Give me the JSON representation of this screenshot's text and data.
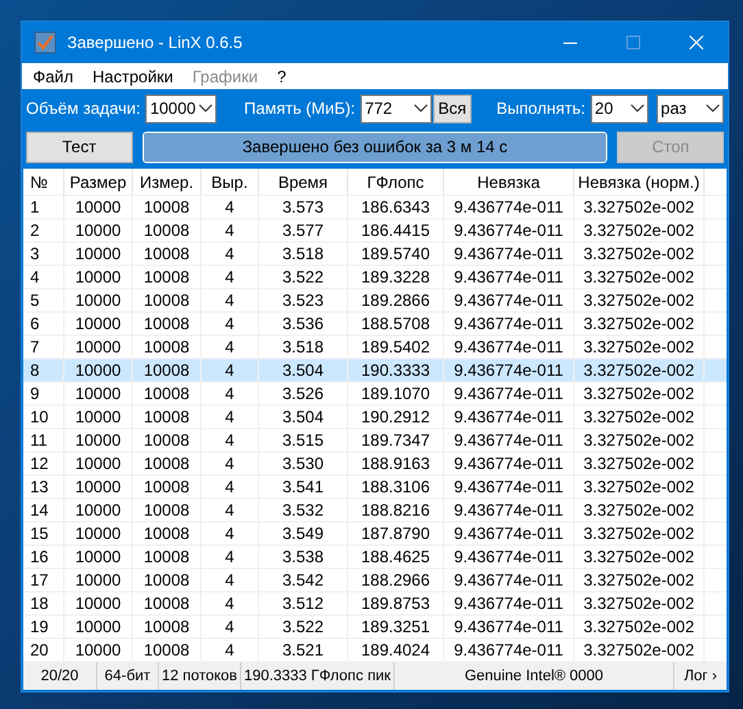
{
  "window": {
    "title": "Завершено - LinX 0.6.5"
  },
  "menu": [
    {
      "label": "Файл",
      "disabled": false
    },
    {
      "label": "Настройки",
      "disabled": false
    },
    {
      "label": "Графики",
      "disabled": true
    },
    {
      "label": "?",
      "disabled": false
    }
  ],
  "options": [
    {
      "label": "Объём задачи:",
      "value": "10000"
    },
    {
      "label": "Память (МиБ):",
      "value": "772",
      "extra": "Вся"
    },
    {
      "label": "Выполнять:",
      "value": "20",
      "units": "раз"
    }
  ],
  "buttons": {
    "start": {
      "label": "Тест",
      "disabled": false
    },
    "stop": {
      "label": "Стоп",
      "disabled": true
    }
  },
  "progress": {
    "text": "Завершено без ошибок за 3 м 14 с",
    "level": 1
  },
  "table": {
    "columns": [
      "№",
      "Размер",
      "Измер.",
      "Выр.",
      "Время",
      "ГФлопс",
      "Невязка",
      "Невязка (норм.)"
    ],
    "rows": [
      {
        "cells": [
          "1",
          "10000",
          "10008",
          "4",
          "3.573",
          "186.6343",
          "9.436774e-011",
          "3.327502e-002"
        ],
        "selected": false
      },
      {
        "cells": [
          "2",
          "10000",
          "10008",
          "4",
          "3.577",
          "186.4415",
          "9.436774e-011",
          "3.327502e-002"
        ],
        "selected": false
      },
      {
        "cells": [
          "3",
          "10000",
          "10008",
          "4",
          "3.518",
          "189.5740",
          "9.436774e-011",
          "3.327502e-002"
        ],
        "selected": false
      },
      {
        "cells": [
          "4",
          "10000",
          "10008",
          "4",
          "3.522",
          "189.3228",
          "9.436774e-011",
          "3.327502e-002"
        ],
        "selected": false
      },
      {
        "cells": [
          "5",
          "10000",
          "10008",
          "4",
          "3.523",
          "189.2866",
          "9.436774e-011",
          "3.327502e-002"
        ],
        "selected": false
      },
      {
        "cells": [
          "6",
          "10000",
          "10008",
          "4",
          "3.536",
          "188.5708",
          "9.436774e-011",
          "3.327502e-002"
        ],
        "selected": false
      },
      {
        "cells": [
          "7",
          "10000",
          "10008",
          "4",
          "3.518",
          "189.5402",
          "9.436774e-011",
          "3.327502e-002"
        ],
        "selected": false
      },
      {
        "cells": [
          "8",
          "10000",
          "10008",
          "4",
          "3.504",
          "190.3333",
          "9.436774e-011",
          "3.327502e-002"
        ],
        "selected": true
      },
      {
        "cells": [
          "9",
          "10000",
          "10008",
          "4",
          "3.526",
          "189.1070",
          "9.436774e-011",
          "3.327502e-002"
        ],
        "selected": false
      },
      {
        "cells": [
          "10",
          "10000",
          "10008",
          "4",
          "3.504",
          "190.2912",
          "9.436774e-011",
          "3.327502e-002"
        ],
        "selected": false
      },
      {
        "cells": [
          "11",
          "10000",
          "10008",
          "4",
          "3.515",
          "189.7347",
          "9.436774e-011",
          "3.327502e-002"
        ],
        "selected": false
      },
      {
        "cells": [
          "12",
          "10000",
          "10008",
          "4",
          "3.530",
          "188.9163",
          "9.436774e-011",
          "3.327502e-002"
        ],
        "selected": false
      },
      {
        "cells": [
          "13",
          "10000",
          "10008",
          "4",
          "3.541",
          "188.3106",
          "9.436774e-011",
          "3.327502e-002"
        ],
        "selected": false
      },
      {
        "cells": [
          "14",
          "10000",
          "10008",
          "4",
          "3.532",
          "188.8216",
          "9.436774e-011",
          "3.327502e-002"
        ],
        "selected": false
      },
      {
        "cells": [
          "15",
          "10000",
          "10008",
          "4",
          "3.549",
          "187.8790",
          "9.436774e-011",
          "3.327502e-002"
        ],
        "selected": false
      },
      {
        "cells": [
          "16",
          "10000",
          "10008",
          "4",
          "3.538",
          "188.4625",
          "9.436774e-011",
          "3.327502e-002"
        ],
        "selected": false
      },
      {
        "cells": [
          "17",
          "10000",
          "10008",
          "4",
          "3.542",
          "188.2966",
          "9.436774e-011",
          "3.327502e-002"
        ],
        "selected": false
      },
      {
        "cells": [
          "18",
          "10000",
          "10008",
          "4",
          "3.512",
          "189.8753",
          "9.436774e-011",
          "3.327502e-002"
        ],
        "selected": false
      },
      {
        "cells": [
          "19",
          "10000",
          "10008",
          "4",
          "3.522",
          "189.3251",
          "9.436774e-011",
          "3.327502e-002"
        ],
        "selected": false
      },
      {
        "cells": [
          "20",
          "10000",
          "10008",
          "4",
          "3.521",
          "189.4024",
          "9.436774e-011",
          "3.327502e-002"
        ],
        "selected": false
      }
    ]
  },
  "status_bar": [
    "20/20",
    "64-бит",
    "12 потоков",
    "190.3333 ГФлопс пик",
    "Genuine Intel® 0000",
    "Лог ›"
  ]
}
